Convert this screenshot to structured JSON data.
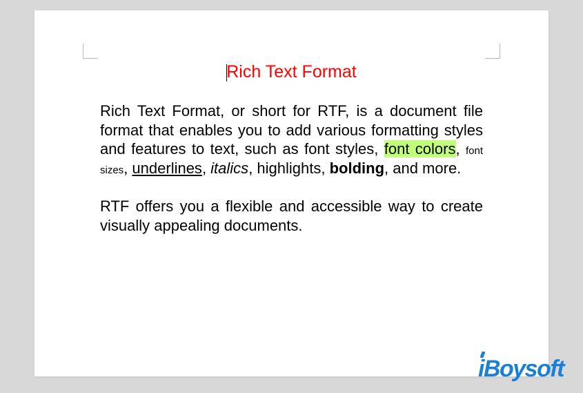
{
  "title": "Rich Text Format",
  "para1": {
    "intro": "Rich Text Format, or short for RTF, is a document file format that enables you to add various formatting styles and features to text, such as font styles, ",
    "font_colors": "font colors",
    "comma1": ", ",
    "font_sizes": "font sizes",
    "comma2": ", ",
    "underlines": "underlines",
    "comma3": ", ",
    "italics": "italics",
    "comma4": ", highlights, ",
    "bolding": "bolding",
    "outro": ", and more."
  },
  "para2": "RTF offers you a flexible and accessible way to create visually appealing documents.",
  "watermark": "iBoysoft"
}
